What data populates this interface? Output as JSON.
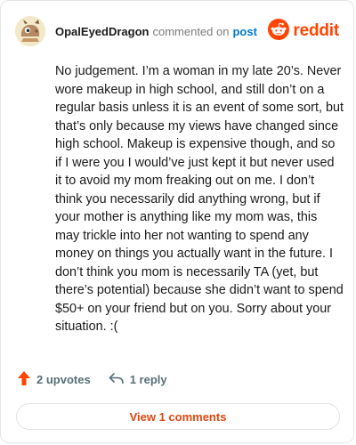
{
  "comment": {
    "author": "OpalEyedDragon",
    "action_text": "commented on",
    "target_link": "post",
    "body": "No judgement. I’m a woman in my late 20’s. Never wore makeup in high school, and still don’t on a regular basis unless it is an event of some sort, but that’s only because my views have changed since high school. Makeup is expensive though, and so if I were you I would’ve just kept it but never used it to avoid my mom freaking out on me. I don’t think you necessarily did anything wrong, but if your mother is anything like my mom was, this may trickle into her not wanting to spend any money on things you actually want in the future. I don’t think you mom is necessarily TA (yet, but there’s potential) because she didn’t want to spend $50+ on your friend but on you. Sorry about your situation. :("
  },
  "brand": {
    "name": "reddit",
    "color": "#ff4500"
  },
  "footer": {
    "upvotes": "2 upvotes",
    "replies": "1 reply"
  },
  "view_comments_button": "View 1 comments",
  "icons": {
    "avatar": "dragon-avatar",
    "brand": "reddit-snoo-icon",
    "upvote": "upvote-arrow-icon",
    "reply": "reply-arrow-icon"
  },
  "colors": {
    "upvote": "#ff4500",
    "link": "#0079d3",
    "button_text": "#e0460f"
  }
}
